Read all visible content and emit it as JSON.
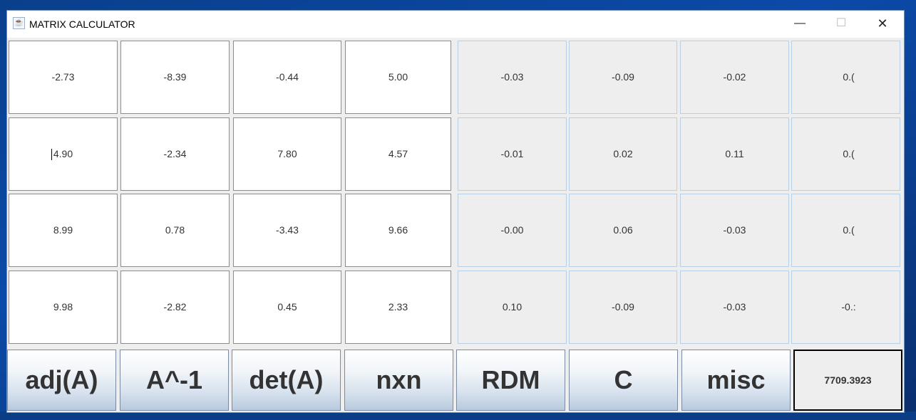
{
  "window": {
    "title": "MATRIX CALCULATOR",
    "minimize_glyph": "—",
    "maximize_glyph": "☐",
    "close_glyph": "✕"
  },
  "matrix_input": [
    [
      "-2.73",
      "-8.39",
      "-0.44",
      "5.00"
    ],
    [
      "4.90",
      "-2.34",
      "7.80",
      "4.57"
    ],
    [
      "8.99",
      "0.78",
      "-3.43",
      "9.66"
    ],
    [
      "9.98",
      "-2.82",
      "0.45",
      "2.33"
    ]
  ],
  "matrix_output": [
    [
      "-0.03",
      "-0.09",
      "-0.02",
      "0.("
    ],
    [
      "-0.01",
      "0.02",
      "0.11",
      "0.("
    ],
    [
      "-0.00",
      "0.06",
      "-0.03",
      "0.("
    ],
    [
      "0.10",
      "-0.09",
      "-0.03",
      "-0.:"
    ]
  ],
  "buttons": {
    "adj": "adj(A)",
    "inv": "A^-1",
    "det": "det(A)",
    "nxn": "nxn",
    "rdm": "RDM",
    "c": "C",
    "misc": "misc"
  },
  "result": "7709.3923",
  "icons": {
    "app": "java-cup-icon",
    "minimize": "minimize-icon",
    "maximize": "maximize-icon",
    "close": "close-icon"
  }
}
